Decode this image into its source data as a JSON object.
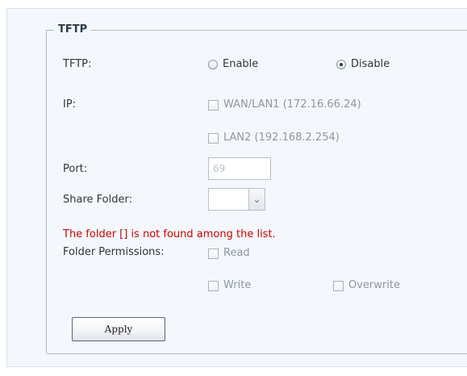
{
  "section": {
    "title": "TFTP"
  },
  "fields": {
    "tftp_label": "TFTP:",
    "ip_label": "IP:",
    "port_label": "Port:",
    "share_folder_label": "Share Folder:",
    "folder_permissions_label": "Folder Permissions:"
  },
  "tftp": {
    "enable_label": "Enable",
    "disable_label": "Disable",
    "selected": "Disable"
  },
  "ip": {
    "wan_label": "WAN/LAN1 (172.16.66.24)",
    "lan2_label": "LAN2 (192.168.2.254)"
  },
  "port": {
    "value": "69"
  },
  "share_folder": {
    "selected": ""
  },
  "error": {
    "message": "The folder [] is not found among the list."
  },
  "permissions": {
    "read_label": "Read",
    "write_label": "Write",
    "overwrite_label": "Overwrite"
  },
  "actions": {
    "apply_label": "Apply"
  },
  "colors": {
    "panel_background": "#f4f8fc",
    "error_text": "#d40000",
    "disabled_text": "#8f969e"
  },
  "icons": {
    "select_arrow": "chevron-down-icon"
  }
}
